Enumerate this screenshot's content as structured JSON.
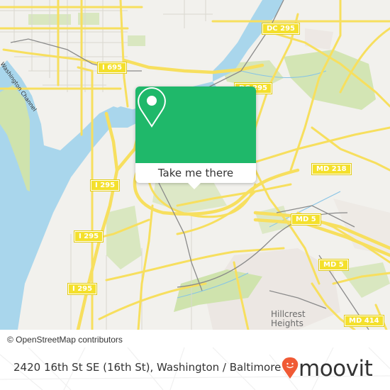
{
  "map": {
    "attribution": "© OpenStreetMap contributors",
    "colors": {
      "land": "#f2f1ed",
      "water": "#a9d6ec",
      "park": "#cfe3ad",
      "road": "#f7df5e",
      "rail": "#8a8a8a",
      "urban": "#e9e3de"
    },
    "route_shields": [
      {
        "label": "I 695"
      },
      {
        "label": "DC 295"
      },
      {
        "label": "DC 295"
      },
      {
        "label": "I 295"
      },
      {
        "label": "I 295"
      },
      {
        "label": "I 295"
      },
      {
        "label": "MD 218"
      },
      {
        "label": "MD 5"
      },
      {
        "label": "MD 5"
      },
      {
        "label": "MD 414"
      }
    ],
    "place_labels": [
      {
        "label": "Hillcrest\nHeights"
      }
    ],
    "water_labels": [
      {
        "label": "Washington Channel"
      }
    ]
  },
  "popup": {
    "action_label": "Take me there",
    "accent_color": "#1fb86a",
    "icon": "map-pin-icon"
  },
  "footer": {
    "address": "2420 16th St SE (16th St), Washington / Baltimore",
    "brand": "moovit",
    "brand_color": "#f05a35",
    "brand_icon": "moovit-pin-icon"
  }
}
